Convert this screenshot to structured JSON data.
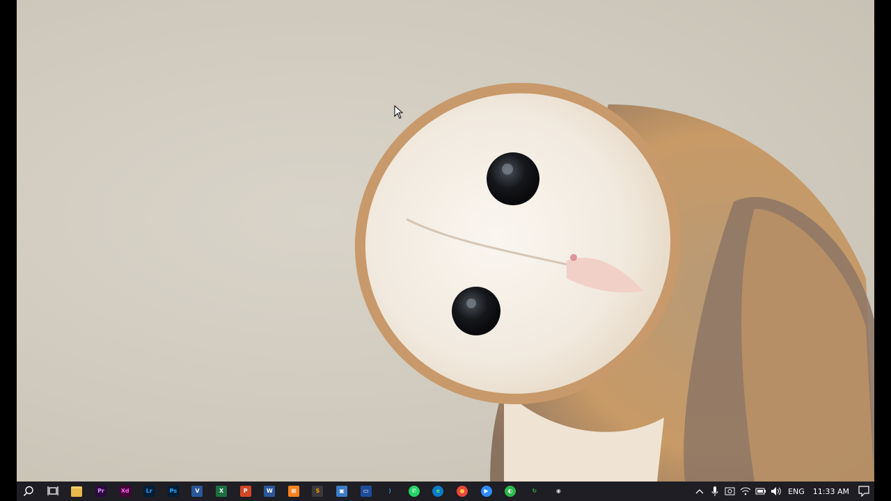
{
  "taskbar": {
    "apps": [
      {
        "name": "file-explorer",
        "label": "",
        "color": "#e8b84a"
      },
      {
        "name": "premiere-pro",
        "label": "Pr",
        "color": "#2a0a3d",
        "fg": "#e08cff"
      },
      {
        "name": "adobe-xd",
        "label": "Xd",
        "color": "#470137",
        "fg": "#ff61f6"
      },
      {
        "name": "lightroom",
        "label": "Lr",
        "color": "#001e36",
        "fg": "#31a8ff"
      },
      {
        "name": "photoshop",
        "label": "Ps",
        "color": "#001e36",
        "fg": "#31a8ff"
      },
      {
        "name": "visio",
        "label": "V",
        "color": "#2b579a",
        "fg": "#ffffff"
      },
      {
        "name": "excel",
        "label": "X",
        "color": "#1d6f42",
        "fg": "#ffffff"
      },
      {
        "name": "powerpoint",
        "label": "P",
        "color": "#d24726",
        "fg": "#ffffff"
      },
      {
        "name": "word",
        "label": "W",
        "color": "#2b579a",
        "fg": "#ffffff"
      },
      {
        "name": "xampp",
        "label": "⊠",
        "color": "#f58220",
        "fg": "#ffffff"
      },
      {
        "name": "sublime-text",
        "label": "S",
        "color": "#3a3a3a",
        "fg": "#ff9800"
      },
      {
        "name": "virtualbox",
        "label": "▣",
        "color": "#3d7bc6",
        "fg": "#ffffff"
      },
      {
        "name": "app-window",
        "label": "▭",
        "color": "#1e4d9b",
        "fg": "#ffffff"
      },
      {
        "name": "vs-code",
        "label": "⟩",
        "color": "#1e1e24",
        "fg": "#2f9de4"
      },
      {
        "name": "whatsapp",
        "label": "✆",
        "color": "#25d366",
        "fg": "#ffffff"
      },
      {
        "name": "edge",
        "label": "e",
        "color": "#0c7cc7",
        "fg": "#5ee07a"
      },
      {
        "name": "chrome",
        "label": "●",
        "color": "#e9463a",
        "fg": "#f7c845"
      },
      {
        "name": "zoom",
        "label": "▶",
        "color": "#2d8cff",
        "fg": "#ffffff"
      },
      {
        "name": "green-app",
        "label": "◐",
        "color": "#2db84c",
        "fg": "#ffffff"
      },
      {
        "name": "browser-green",
        "label": "↻",
        "color": "#1e1e24",
        "fg": "#3dbb4a"
      },
      {
        "name": "obs-studio",
        "label": "◉",
        "color": "#1e1e24",
        "fg": "#dddddd"
      }
    ],
    "tray": {
      "language": "ENG",
      "time": "11:33 AM"
    }
  }
}
